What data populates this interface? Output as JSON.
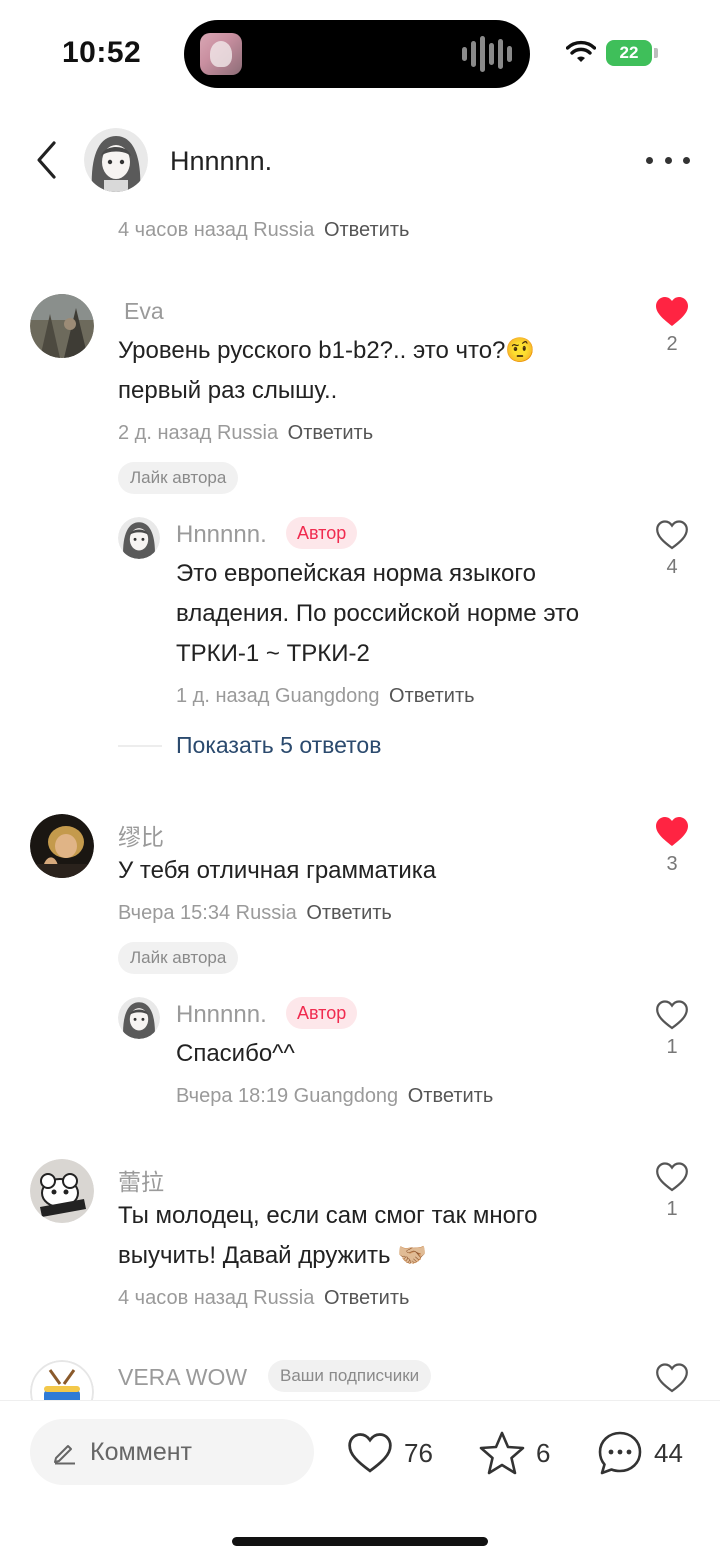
{
  "status_bar": {
    "time": "10:52",
    "battery": "22"
  },
  "header": {
    "title": "Hnnnnn."
  },
  "comments": [
    {
      "meta": {
        "time": "4 часов назад",
        "location": "Russia",
        "reply": "Ответить"
      }
    },
    {
      "name": "Eva",
      "text": "Уровень русского b1-b2?.. это что?🤨 первый раз слышу..",
      "meta": {
        "time": "2 д. назад",
        "location": "Russia",
        "reply": "Ответить"
      },
      "likes": "2",
      "tag": "Лайк автора",
      "reply": {
        "name": "Hnnnnn.",
        "badge": "Автор",
        "text": "Это европейская норма языкого владения. По российской норме это ТРКИ-1 ~ ТРКИ-2",
        "meta": {
          "time": "1 д. назад",
          "location": "Guangdong",
          "reply": "Ответить"
        },
        "likes": "4"
      },
      "show_more": "Показать 5 ответов"
    },
    {
      "name": "缪比",
      "text": "У тебя отличная грамматика",
      "meta": {
        "time": "Вчера 15:34",
        "location": "Russia",
        "reply": "Ответить"
      },
      "likes": "3",
      "tag": "Лайк автора",
      "reply": {
        "name": "Hnnnnn.",
        "badge": "Автор",
        "text": "Спасибо^^",
        "meta": {
          "time": "Вчера 18:19",
          "location": "Guangdong",
          "reply": "Ответить"
        },
        "likes": "1"
      }
    },
    {
      "name": "蕾拉",
      "text": "Ты молодец, если сам смог так много выучить! Давай дружить 🤝🏼",
      "meta": {
        "time": "4 часов назад",
        "location": "Russia",
        "reply": "Ответить"
      },
      "likes": "1"
    },
    {
      "name": "VERA WOW",
      "badge": "Ваши подписчики"
    }
  ],
  "bottom_bar": {
    "comment_placeholder": "Коммент",
    "likes": "76",
    "favorites": "6",
    "comments": "44"
  },
  "colors": {
    "liked": "#ff2442",
    "author_badge_text": "#f02b4f",
    "link": "#2b4a6e",
    "battery": "#3fbf5a"
  }
}
